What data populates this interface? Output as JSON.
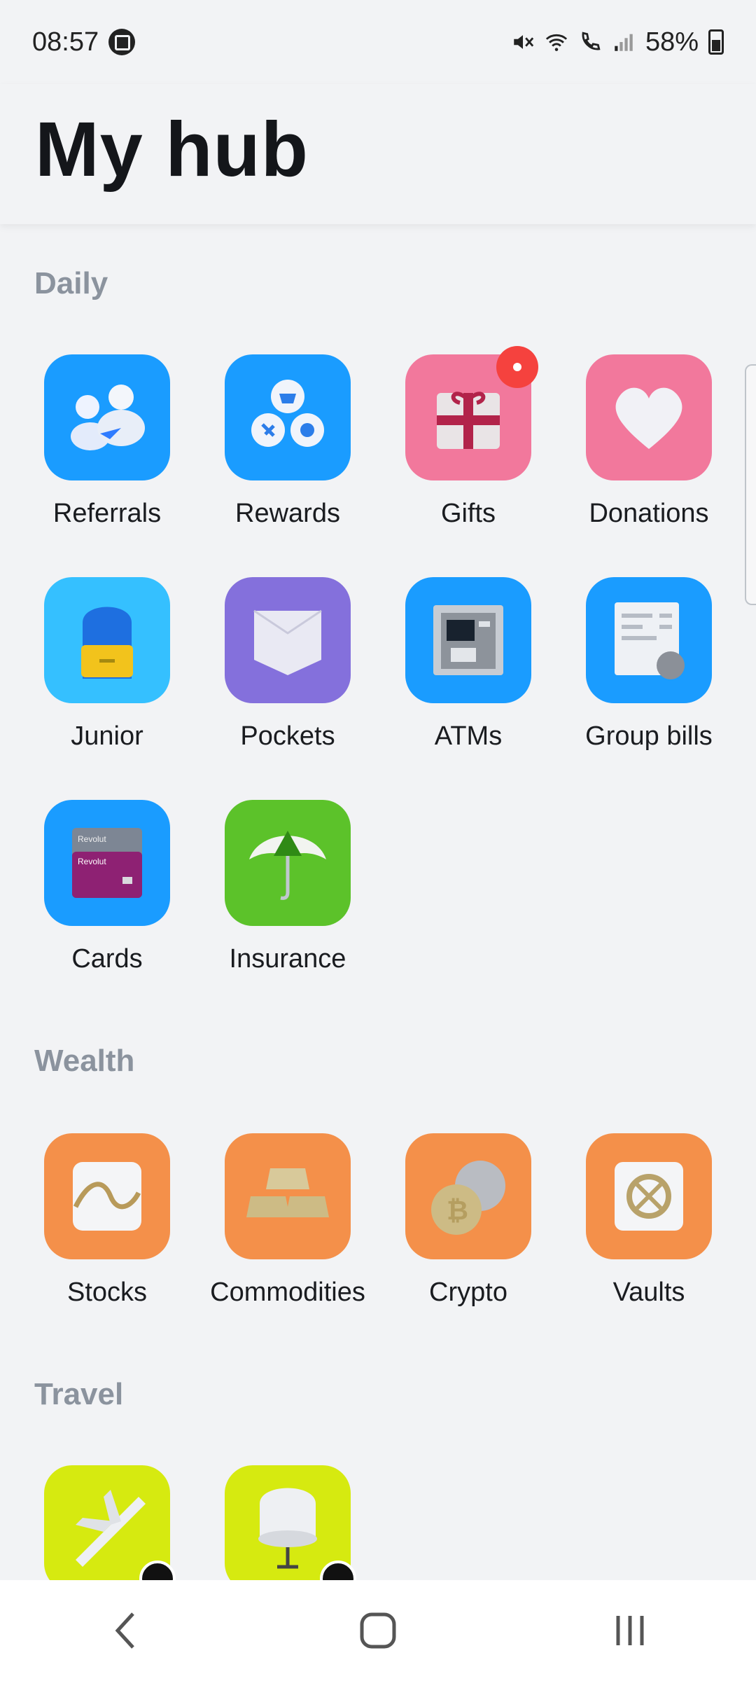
{
  "status": {
    "time": "08:57",
    "battery": "58%"
  },
  "header": {
    "title": "My hub"
  },
  "sections": {
    "daily": {
      "title": "Daily",
      "items": [
        {
          "label": "Referrals"
        },
        {
          "label": "Rewards"
        },
        {
          "label": "Gifts"
        },
        {
          "label": "Donations"
        },
        {
          "label": "Junior"
        },
        {
          "label": "Pockets"
        },
        {
          "label": "ATMs"
        },
        {
          "label": "Group bills"
        },
        {
          "label": "Cards"
        },
        {
          "label": "Insurance"
        }
      ]
    },
    "wealth": {
      "title": "Wealth",
      "items": [
        {
          "label": "Stocks"
        },
        {
          "label": "Commodities"
        },
        {
          "label": "Crypto"
        },
        {
          "label": "Vaults"
        }
      ]
    },
    "travel": {
      "title": "Travel",
      "items": [
        {
          "label": ""
        },
        {
          "label": ""
        }
      ]
    }
  },
  "card_brand": "Revolut",
  "colors": {
    "blue": "#1a9cff",
    "pink": "#f2789c",
    "purple": "#8470dc",
    "green": "#5cc22a",
    "orange": "#f4904a",
    "lime": "#d6ea10"
  }
}
